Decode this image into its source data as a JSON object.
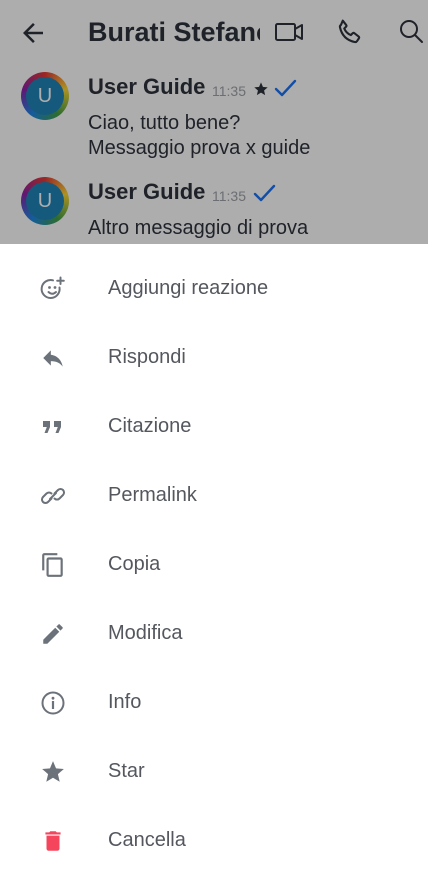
{
  "header": {
    "title": "Burati Stefano"
  },
  "messages": [
    {
      "user": "User Guide",
      "time": "11:35",
      "starred": true,
      "avatar_letter": "U",
      "lines": [
        "Ciao, tutto bene?",
        "Messaggio prova x guide"
      ]
    },
    {
      "user": "User Guide",
      "time": "11:35",
      "starred": false,
      "avatar_letter": "U",
      "lines": [
        "Altro messaggio di prova"
      ]
    }
  ],
  "actions": [
    {
      "label": "Aggiungi reazione",
      "icon": "add-reaction-icon"
    },
    {
      "label": "Rispondi",
      "icon": "reply-icon"
    },
    {
      "label": "Citazione",
      "icon": "quote-icon"
    },
    {
      "label": "Permalink",
      "icon": "link-icon"
    },
    {
      "label": "Copia",
      "icon": "copy-icon"
    },
    {
      "label": "Modifica",
      "icon": "pencil-icon"
    },
    {
      "label": "Info",
      "icon": "info-icon"
    },
    {
      "label": "Star",
      "icon": "star-icon"
    },
    {
      "label": "Cancella",
      "icon": "trash-icon"
    }
  ],
  "colors": {
    "text_primary": "#2f343d",
    "action_text": "#54585e",
    "icon_gray": "#6c727a",
    "delete_red": "#f5455c",
    "check_blue": "#1d74f5",
    "avatar_bg": "#1f84b8"
  }
}
